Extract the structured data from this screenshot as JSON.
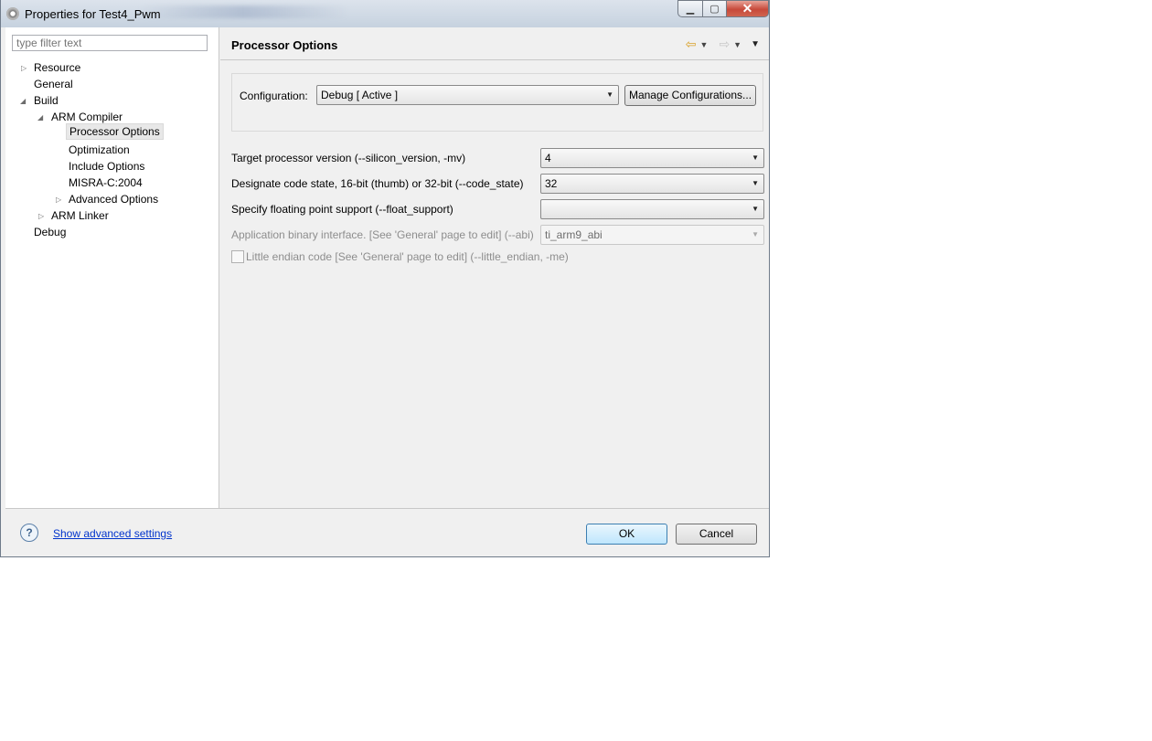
{
  "window": {
    "title": "Properties for Test4_Pwm"
  },
  "filter": {
    "placeholder": "type filter text"
  },
  "tree": {
    "resource": "Resource",
    "general": "General",
    "build": "Build",
    "arm_compiler": "ARM Compiler",
    "processor_options": "Processor Options",
    "optimization": "Optimization",
    "include_options": "Include Options",
    "misra": "MISRA-C:2004",
    "advanced_options": "Advanced Options",
    "arm_linker": "ARM Linker",
    "debug": "Debug"
  },
  "page": {
    "title": "Processor Options"
  },
  "configuration": {
    "label": "Configuration:",
    "value": "Debug  [ Active ]",
    "manage_button": "Manage Configurations..."
  },
  "options": {
    "silicon_label": "Target processor version (--silicon_version, -mv)",
    "silicon_value": "4",
    "code_state_label": "Designate code state, 16-bit (thumb) or 32-bit (--code_state)",
    "code_state_value": "32",
    "float_label": "Specify floating point support (--float_support)",
    "float_value": "",
    "abi_label": "Application binary interface. [See 'General' page to edit] (--abi)",
    "abi_value": "ti_arm9_abi",
    "endian_label": "Little endian code [See 'General' page to edit] (--little_endian, -me)"
  },
  "footer": {
    "help_icon": "?",
    "advanced_link": "Show advanced settings",
    "ok": "OK",
    "cancel": "Cancel"
  },
  "icons": {
    "back": "back-arrow-icon",
    "forward": "forward-arrow-icon",
    "view_menu": "view-menu-icon"
  }
}
